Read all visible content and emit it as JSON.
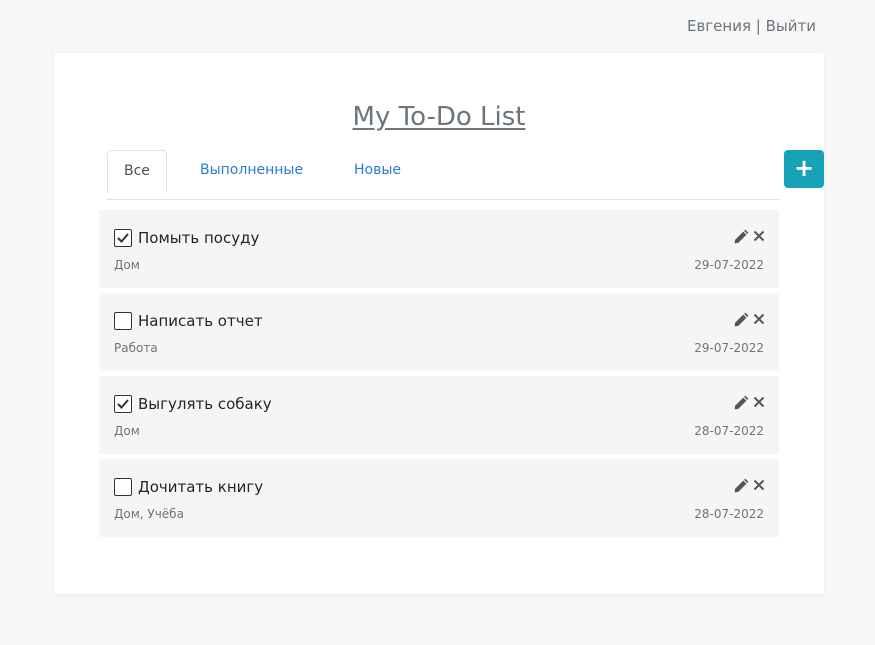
{
  "header": {
    "user_name": "Евгения",
    "separator": "|",
    "logout_label": "Выйти"
  },
  "page": {
    "title": "My To-Do List"
  },
  "tabs": [
    {
      "label": "Все",
      "active": true
    },
    {
      "label": "Выполненные",
      "active": false
    },
    {
      "label": "Новые",
      "active": false
    }
  ],
  "add_button": {
    "label": "+"
  },
  "tasks": [
    {
      "title": "Помыть посуду",
      "done": true,
      "tags": "Дом",
      "date": "29-07-2022"
    },
    {
      "title": "Написать отчет",
      "done": false,
      "tags": "Работа",
      "date": "29-07-2022"
    },
    {
      "title": "Выгулять собаку",
      "done": true,
      "tags": "Дом",
      "date": "28-07-2022"
    },
    {
      "title": "Дочитать книгу",
      "done": false,
      "tags": "Дом, Учёба",
      "date": "28-07-2022"
    }
  ],
  "icons": {
    "edit": "pencil-icon",
    "delete": "close-icon",
    "check": "checkmark-icon"
  },
  "colors": {
    "accent": "#17a2b8",
    "link": "#2a7bd4",
    "muted": "#6c757d",
    "item_bg": "#f5f5f5"
  }
}
